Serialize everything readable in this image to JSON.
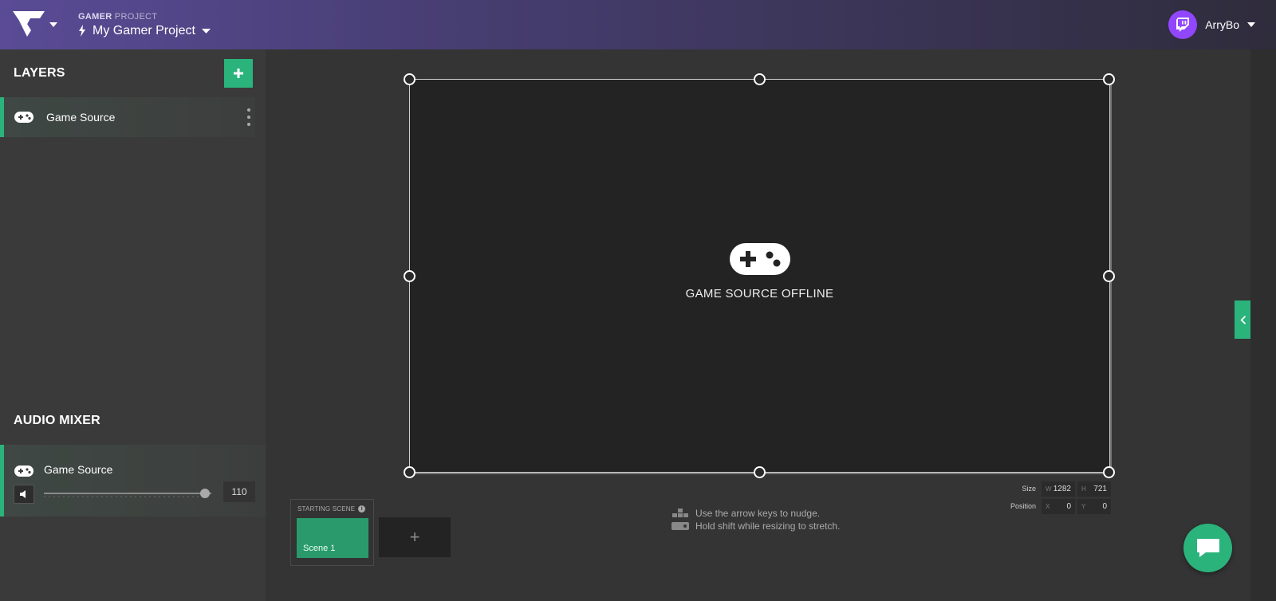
{
  "header": {
    "project_label_bold": "GAMER",
    "project_label_rest": " PROJECT",
    "project_name": "My Gamer Project",
    "username": "ArryBo"
  },
  "sidebar": {
    "layers_title": "LAYERS",
    "layers": [
      {
        "label": "Game Source",
        "icon": "gamepad-icon"
      }
    ],
    "audio_title": "AUDIO MIXER",
    "mixer": [
      {
        "label": "Game Source",
        "volume": 110,
        "volume_fraction": 0.96
      }
    ]
  },
  "canvas": {
    "offline_text": "GAME SOURCE OFFLINE",
    "size_label": "Size",
    "position_label": "Position",
    "w_key": "W",
    "w_value": "1282",
    "h_key": "H",
    "h_value": "721",
    "x_key": "X",
    "x_value": "0",
    "y_key": "Y",
    "y_value": "0"
  },
  "hints": {
    "nudge": "Use the arrow keys to nudge.",
    "stretch": "Hold shift while resizing to stretch."
  },
  "scenes": {
    "starting_label": "STARTING SCENE",
    "items": [
      {
        "label": "Scene 1"
      }
    ],
    "add_label": "+"
  },
  "colors": {
    "accent": "#2bb37c",
    "header_purple": "#5a4b96",
    "twitch_purple": "#9146ff"
  }
}
